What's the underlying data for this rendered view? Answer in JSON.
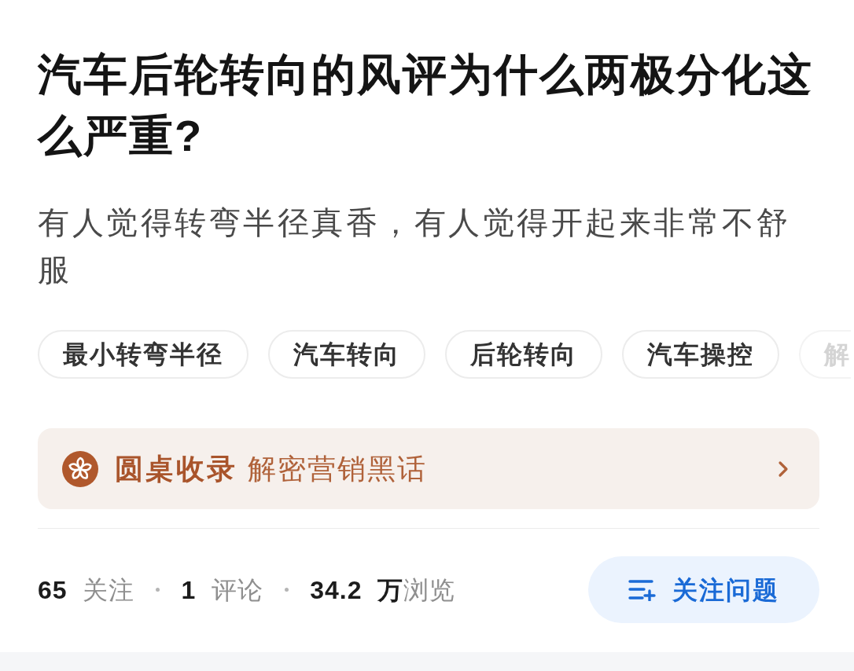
{
  "question": {
    "title": "汽车后轮转向的风评为什么两极分化这么严重?",
    "description": "有人觉得转弯半径真香，有人觉得开起来非常不舒服"
  },
  "topics": [
    "最小转弯半径",
    "汽车转向",
    "后轮转向",
    "汽车操控",
    "解"
  ],
  "collection_card": {
    "label": "圆桌收录",
    "title": "解密营销黑话"
  },
  "stats": [
    "**65** 关注",
    "**1** 评论",
    "**34.2 万**浏览"
  ],
  "follow_button": {
    "label": "关注问题"
  }
}
